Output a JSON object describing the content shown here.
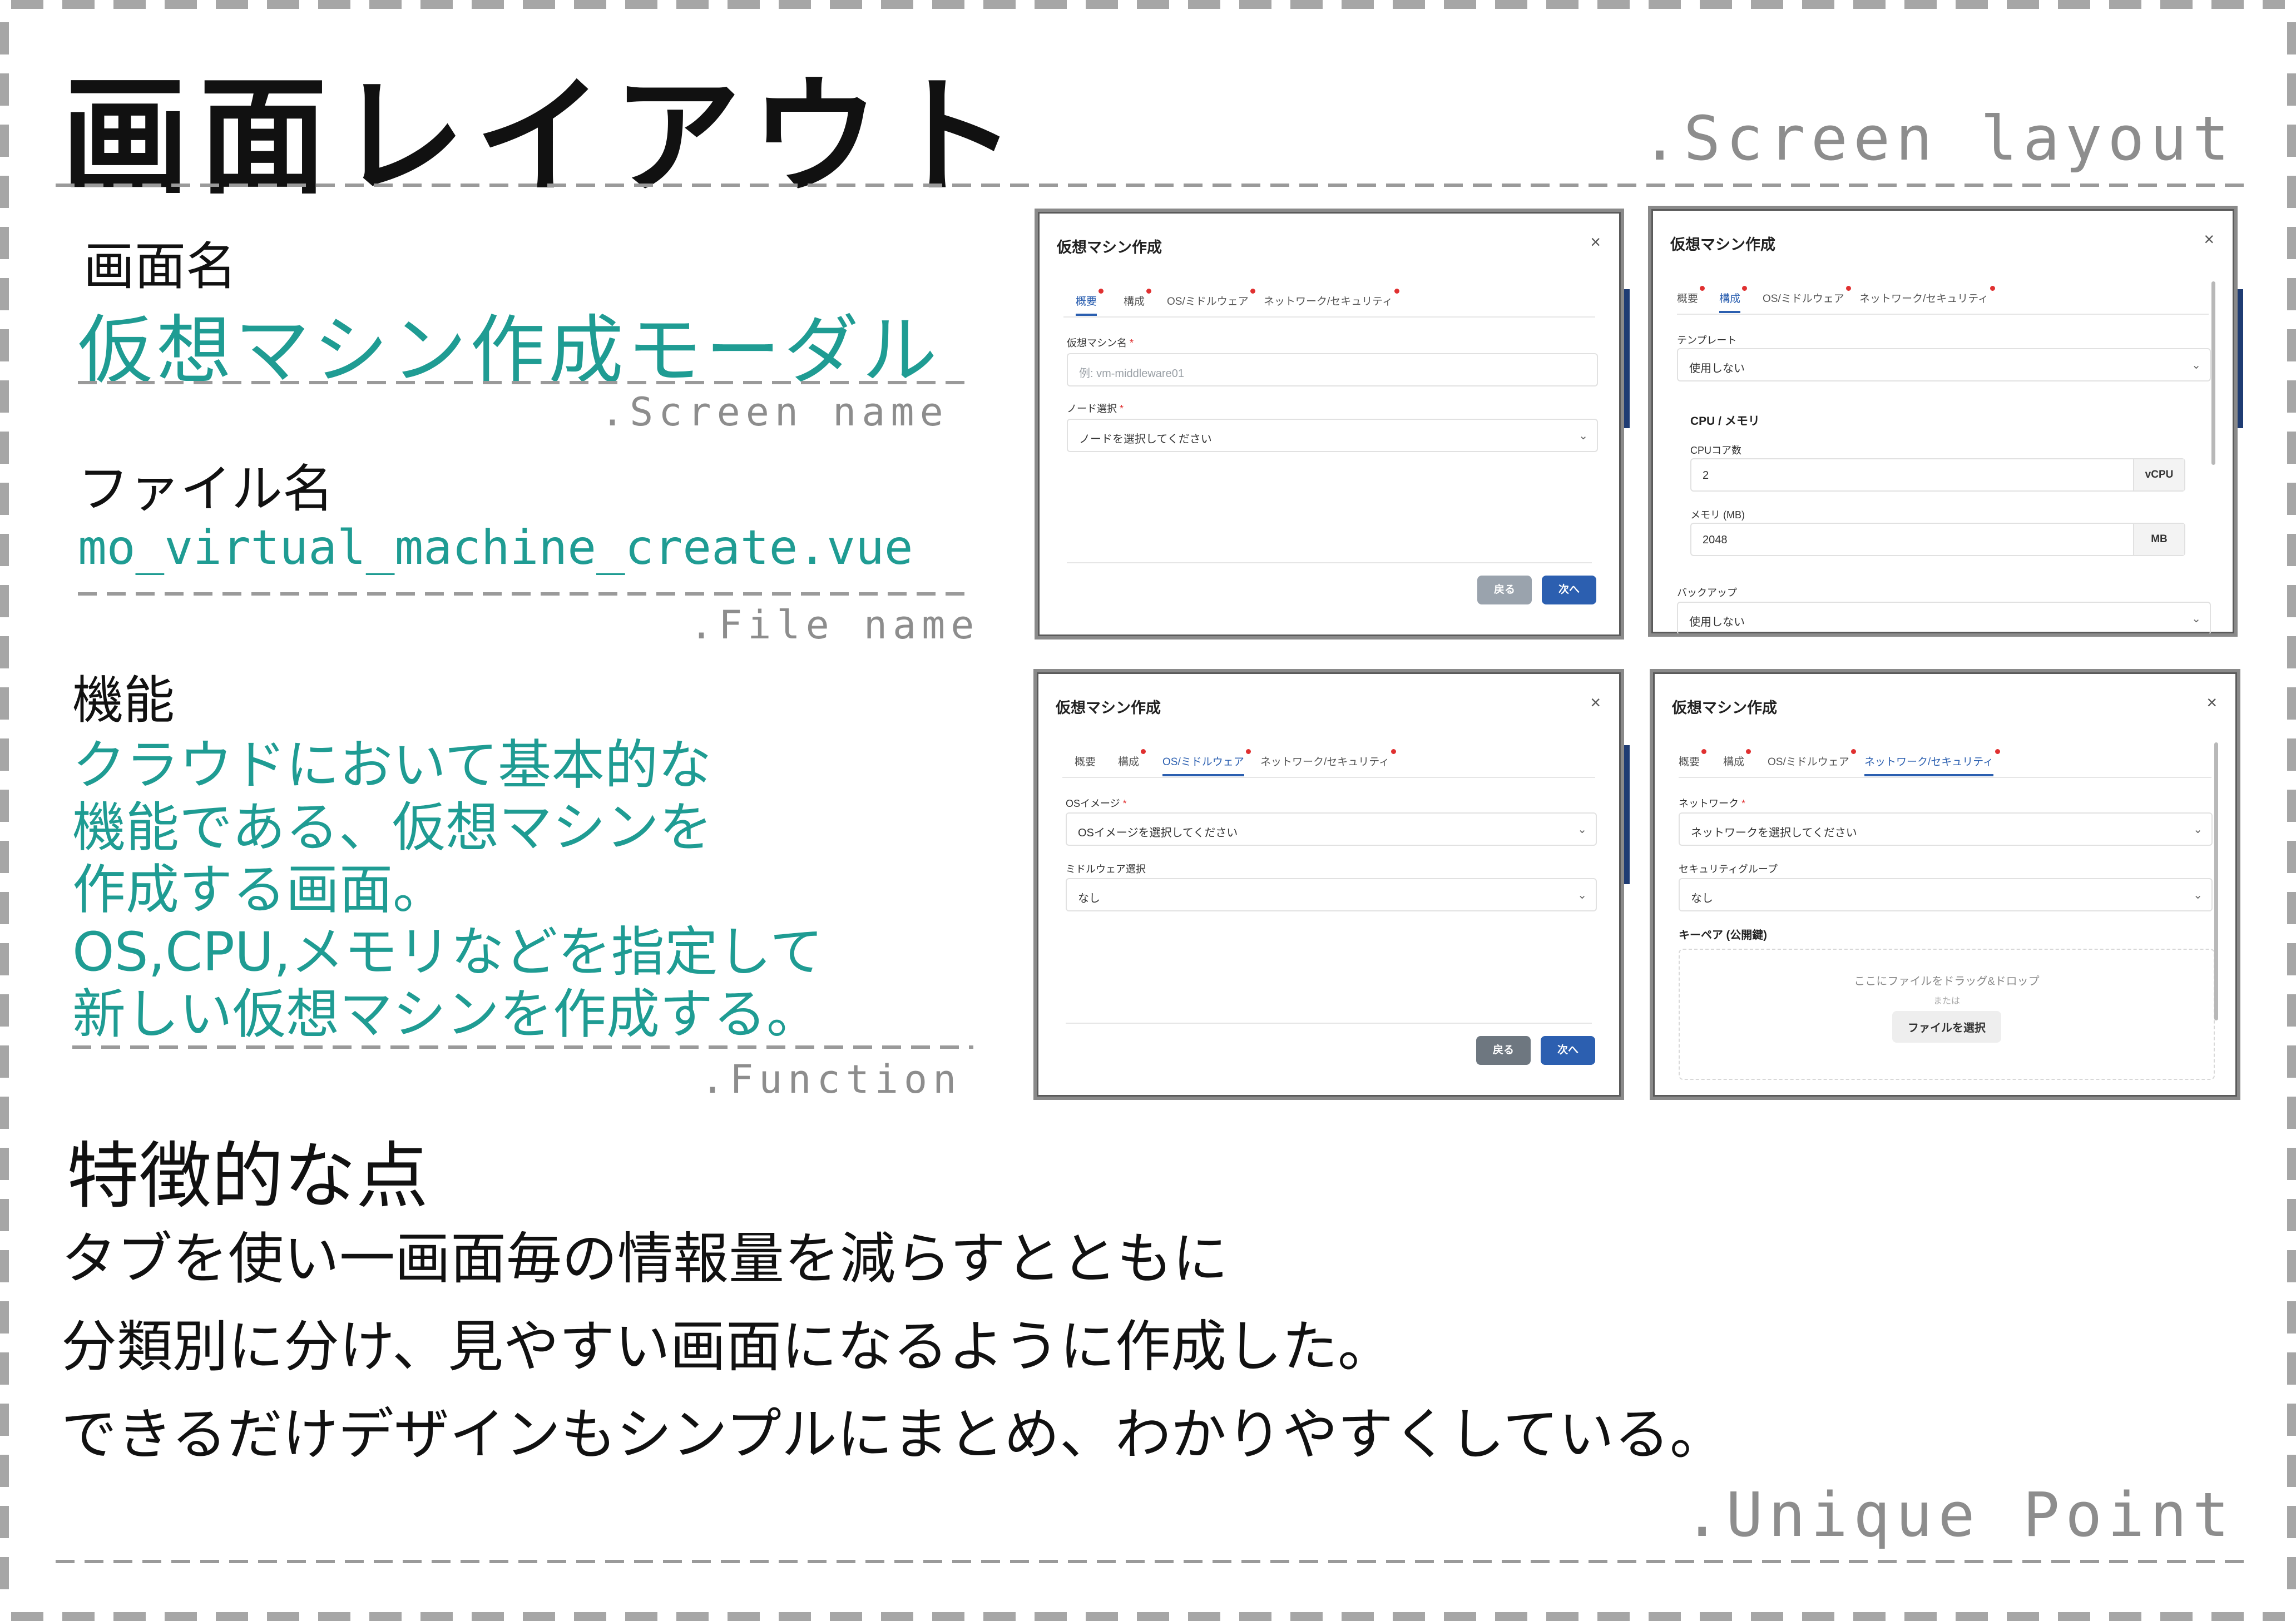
{
  "header": {
    "title": "画面レイアウト",
    "title_en": ".Screen layout"
  },
  "screen_name": {
    "label": "画面名",
    "value": "仮想マシン作成モーダル",
    "en": ".Screen name"
  },
  "file_name": {
    "label": "ファイル名",
    "value": "mo_virtual_machine_create.vue",
    "en": ".File name"
  },
  "function": {
    "label": "機能",
    "lines": [
      "クラウドにおいて基本的な",
      "機能である、仮想マシンを",
      "作成する画面。",
      "OS,CPU,メモリなどを指定して",
      "新しい仮想マシンを作成する。"
    ],
    "en": ".Function"
  },
  "unique_point": {
    "label": "特徴的な点",
    "lines": [
      "タブを使い一画面毎の情報量を減らすとともに",
      "分類別に分け、見やすい画面になるように作成した。",
      "できるだけデザインもシンプルにまとめ、わかりやすくしている。"
    ],
    "en": ".Unique Point"
  },
  "modal": {
    "title": "仮想マシン作成",
    "close": "×",
    "tabs": [
      "概要",
      "構成",
      "OS/ミドルウェア",
      "ネットワーク/セキュリティ"
    ],
    "back": "戻る",
    "next": "次へ"
  },
  "shot1": {
    "vm_name_label": "仮想マシン名",
    "vm_name_placeholder": "例: vm-middleware01",
    "node_label": "ノード選択",
    "node_value": "ノードを選択してください"
  },
  "shot2": {
    "template_label": "テンプレート",
    "template_value": "使用しない",
    "cpu_mem_title": "CPU / メモリ",
    "cpu_label": "CPUコア数",
    "cpu_value": "2",
    "cpu_unit": "vCPU",
    "mem_label": "メモリ (MB)",
    "mem_value": "2048",
    "mem_unit": "MB",
    "backup_label": "バックアップ",
    "backup_value": "使用しない"
  },
  "shot3": {
    "os_label": "OSイメージ",
    "os_value": "OSイメージを選択してください",
    "mw_label": "ミドルウェア選択",
    "mw_value": "なし"
  },
  "shot4": {
    "network_label": "ネットワーク",
    "network_value": "ネットワークを選択してください",
    "sg_label": "セキュリティグループ",
    "sg_value": "なし",
    "keypair_label": "キーペア (公開鍵)",
    "drop_text": "ここにファイルをドラッグ&ドロップ",
    "or_text": "または",
    "file_button": "ファイルを選択"
  },
  "colors": {
    "accent_teal": "#1f9c93",
    "primary_blue": "#2c5fb0",
    "required_red": "#e03030"
  }
}
